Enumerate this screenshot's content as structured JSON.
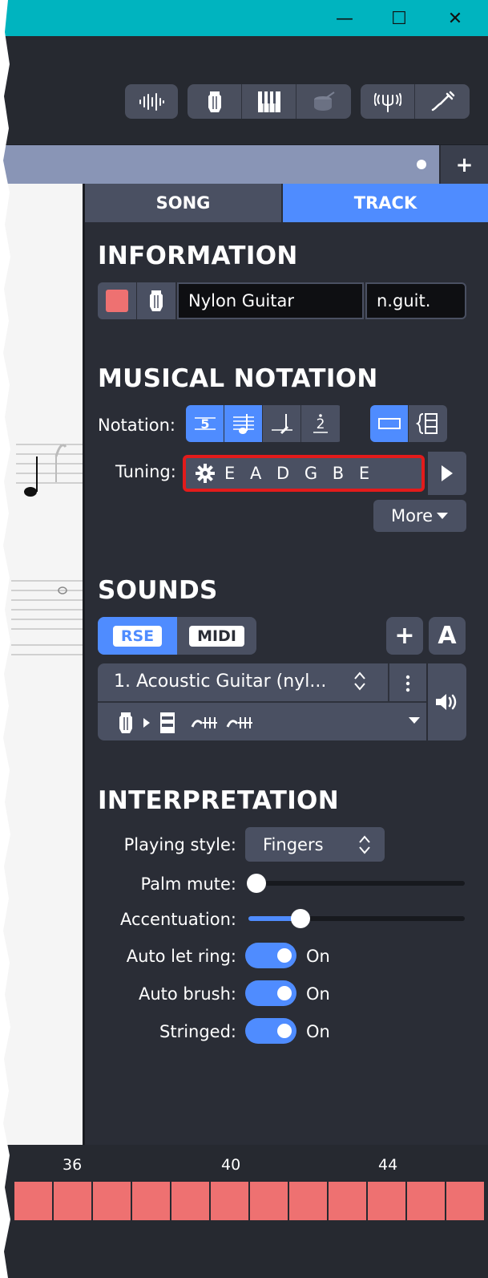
{
  "titlebar": {
    "minimize": "—",
    "maximize": "☐",
    "close": "✕"
  },
  "toolbar": {
    "icons": [
      "waveform-icon",
      "guitar-icon",
      "piano-icon",
      "drum-icon",
      "tuner-icon",
      "jack-icon"
    ]
  },
  "tabstrip": {
    "add": "+"
  },
  "panel": {
    "tabs": {
      "song": "SONG",
      "track": "TRACK"
    },
    "information": {
      "title": "INFORMATION",
      "track_color": "#ee7171",
      "name": "Nylon Guitar",
      "short_name": "n.guit."
    },
    "notation": {
      "title": "MUSICAL NOTATION",
      "notation_label": "Notation:",
      "tuning_label": "Tuning:",
      "tuning_value": "E A D G B E",
      "more_label": "More"
    },
    "sounds": {
      "title": "SOUNDS",
      "rse": "RSE",
      "midi": "MIDI",
      "add": "+",
      "auto": "A",
      "sound_name": "1. Acoustic Guitar (nyl..."
    },
    "interpretation": {
      "title": "INTERPRETATION",
      "playing_style_label": "Playing style:",
      "playing_style_value": "Fingers",
      "palm_mute_label": "Palm mute:",
      "palm_mute_value": 0,
      "accentuation_label": "Accentuation:",
      "accentuation_value": 0.24,
      "auto_let_ring_label": "Auto let ring:",
      "auto_let_ring_value": "On",
      "auto_brush_label": "Auto brush:",
      "auto_brush_value": "On",
      "stringed_label": "Stringed:",
      "stringed_value": "On"
    }
  },
  "timeline": {
    "bar_numbers": [
      "36",
      "40",
      "44"
    ]
  },
  "colors": {
    "accent": "#4f8cff",
    "titlebar": "#00b4bf",
    "track": "#ee7171",
    "highlight": "#e31b1b"
  }
}
